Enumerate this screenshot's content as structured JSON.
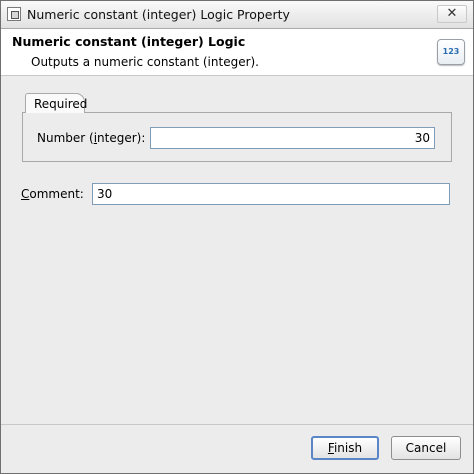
{
  "window": {
    "title": "Numeric constant (integer) Logic Property",
    "close_glyph": "✕"
  },
  "header": {
    "title": "Numeric constant (integer) Logic",
    "description": "Outputs a numeric constant (integer).",
    "icon_label": "123",
    "icon_name": "numeric-constant-icon"
  },
  "tabs": {
    "required_label": "Required"
  },
  "fields": {
    "number_label": "Number (integer):",
    "number_value": "30",
    "comment_label": "Comment:",
    "comment_value": "30"
  },
  "buttons": {
    "finish_label": "Finish",
    "cancel_label": "Cancel"
  },
  "colors": {
    "window_bg": "#ececec",
    "header_bg": "#ffffff",
    "default_button_border": "#5a86c7"
  }
}
